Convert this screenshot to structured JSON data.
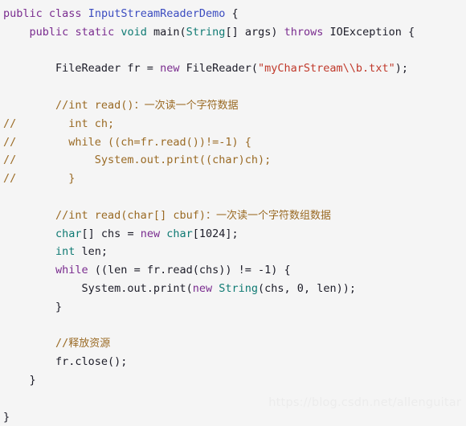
{
  "editor": {
    "background_color": "#f5f5f5",
    "language": "Java",
    "syntax_colors": {
      "keyword": "#7a2c8f",
      "type": "#0f7a73",
      "classname": "#3b4cc0",
      "plain": "#1c1c28",
      "string": "#c0392b",
      "comment": "#9a6a24",
      "number": "#1c1c28"
    }
  },
  "watermark": {
    "text": "https://blog.csdn.net/allenguitar",
    "color": "#ececec"
  },
  "code": {
    "lines": [
      {
        "n": 1,
        "tokens": [
          {
            "t": "public",
            "c": "keyword"
          },
          {
            "t": " ",
            "c": "plain"
          },
          {
            "t": "class",
            "c": "keyword"
          },
          {
            "t": " ",
            "c": "plain"
          },
          {
            "t": "InputStreamReaderDemo",
            "c": "classname"
          },
          {
            "t": " {",
            "c": "plain"
          }
        ]
      },
      {
        "n": 2,
        "tokens": [
          {
            "t": "    ",
            "c": "plain"
          },
          {
            "t": "public",
            "c": "keyword"
          },
          {
            "t": " ",
            "c": "plain"
          },
          {
            "t": "static",
            "c": "keyword"
          },
          {
            "t": " ",
            "c": "plain"
          },
          {
            "t": "void",
            "c": "type"
          },
          {
            "t": " main(",
            "c": "plain"
          },
          {
            "t": "String",
            "c": "type"
          },
          {
            "t": "[] args) ",
            "c": "plain"
          },
          {
            "t": "throws",
            "c": "keyword"
          },
          {
            "t": " IOException {",
            "c": "plain"
          }
        ]
      },
      {
        "n": 3,
        "tokens": []
      },
      {
        "n": 4,
        "tokens": [
          {
            "t": "        FileReader fr = ",
            "c": "plain"
          },
          {
            "t": "new",
            "c": "keyword"
          },
          {
            "t": " FileReader(",
            "c": "plain"
          },
          {
            "t": "\"myCharStream\\\\b.txt\"",
            "c": "string"
          },
          {
            "t": ");",
            "c": "plain"
          }
        ]
      },
      {
        "n": 5,
        "tokens": []
      },
      {
        "n": 6,
        "tokens": [
          {
            "t": "        //int read()",
            "c": "comment"
          },
          {
            "t": "：一次读一个字符数据",
            "c": "comment",
            "cjk": true
          }
        ]
      },
      {
        "n": 7,
        "tokens": [
          {
            "t": "//        int ch;",
            "c": "comment"
          }
        ]
      },
      {
        "n": 8,
        "tokens": [
          {
            "t": "//        while ((ch=fr.read())!=-1) {",
            "c": "comment"
          }
        ]
      },
      {
        "n": 9,
        "tokens": [
          {
            "t": "//            System.out.print((char)ch);",
            "c": "comment"
          }
        ]
      },
      {
        "n": 10,
        "tokens": [
          {
            "t": "//        }",
            "c": "comment"
          }
        ]
      },
      {
        "n": 11,
        "tokens": []
      },
      {
        "n": 12,
        "tokens": [
          {
            "t": "        //int read(char[] cbuf)",
            "c": "comment"
          },
          {
            "t": "：一次读一个字符数组数据",
            "c": "comment",
            "cjk": true
          }
        ]
      },
      {
        "n": 13,
        "tokens": [
          {
            "t": "        ",
            "c": "plain"
          },
          {
            "t": "char",
            "c": "type"
          },
          {
            "t": "[] chs = ",
            "c": "plain"
          },
          {
            "t": "new",
            "c": "keyword"
          },
          {
            "t": " ",
            "c": "plain"
          },
          {
            "t": "char",
            "c": "type"
          },
          {
            "t": "[",
            "c": "plain"
          },
          {
            "t": "1024",
            "c": "number"
          },
          {
            "t": "];",
            "c": "plain"
          }
        ]
      },
      {
        "n": 14,
        "tokens": [
          {
            "t": "        ",
            "c": "plain"
          },
          {
            "t": "int",
            "c": "type"
          },
          {
            "t": " len;",
            "c": "plain"
          }
        ]
      },
      {
        "n": 15,
        "tokens": [
          {
            "t": "        ",
            "c": "plain"
          },
          {
            "t": "while",
            "c": "keyword"
          },
          {
            "t": " ((len = fr.read(chs)) != -",
            "c": "plain"
          },
          {
            "t": "1",
            "c": "number"
          },
          {
            "t": ") {",
            "c": "plain"
          }
        ]
      },
      {
        "n": 16,
        "tokens": [
          {
            "t": "            System.out.print(",
            "c": "plain"
          },
          {
            "t": "new",
            "c": "keyword"
          },
          {
            "t": " ",
            "c": "plain"
          },
          {
            "t": "String",
            "c": "type"
          },
          {
            "t": "(chs, ",
            "c": "plain"
          },
          {
            "t": "0",
            "c": "number"
          },
          {
            "t": ", len));",
            "c": "plain"
          }
        ]
      },
      {
        "n": 17,
        "tokens": [
          {
            "t": "        }",
            "c": "plain"
          }
        ]
      },
      {
        "n": 18,
        "tokens": []
      },
      {
        "n": 19,
        "tokens": [
          {
            "t": "        //",
            "c": "comment"
          },
          {
            "t": "释放资源",
            "c": "comment",
            "cjk": true
          }
        ]
      },
      {
        "n": 20,
        "tokens": [
          {
            "t": "        fr.close();",
            "c": "plain"
          }
        ]
      },
      {
        "n": 21,
        "tokens": [
          {
            "t": "    }",
            "c": "plain"
          }
        ]
      },
      {
        "n": 22,
        "tokens": []
      },
      {
        "n": 23,
        "tokens": [
          {
            "t": "}",
            "c": "plain"
          }
        ]
      }
    ]
  }
}
